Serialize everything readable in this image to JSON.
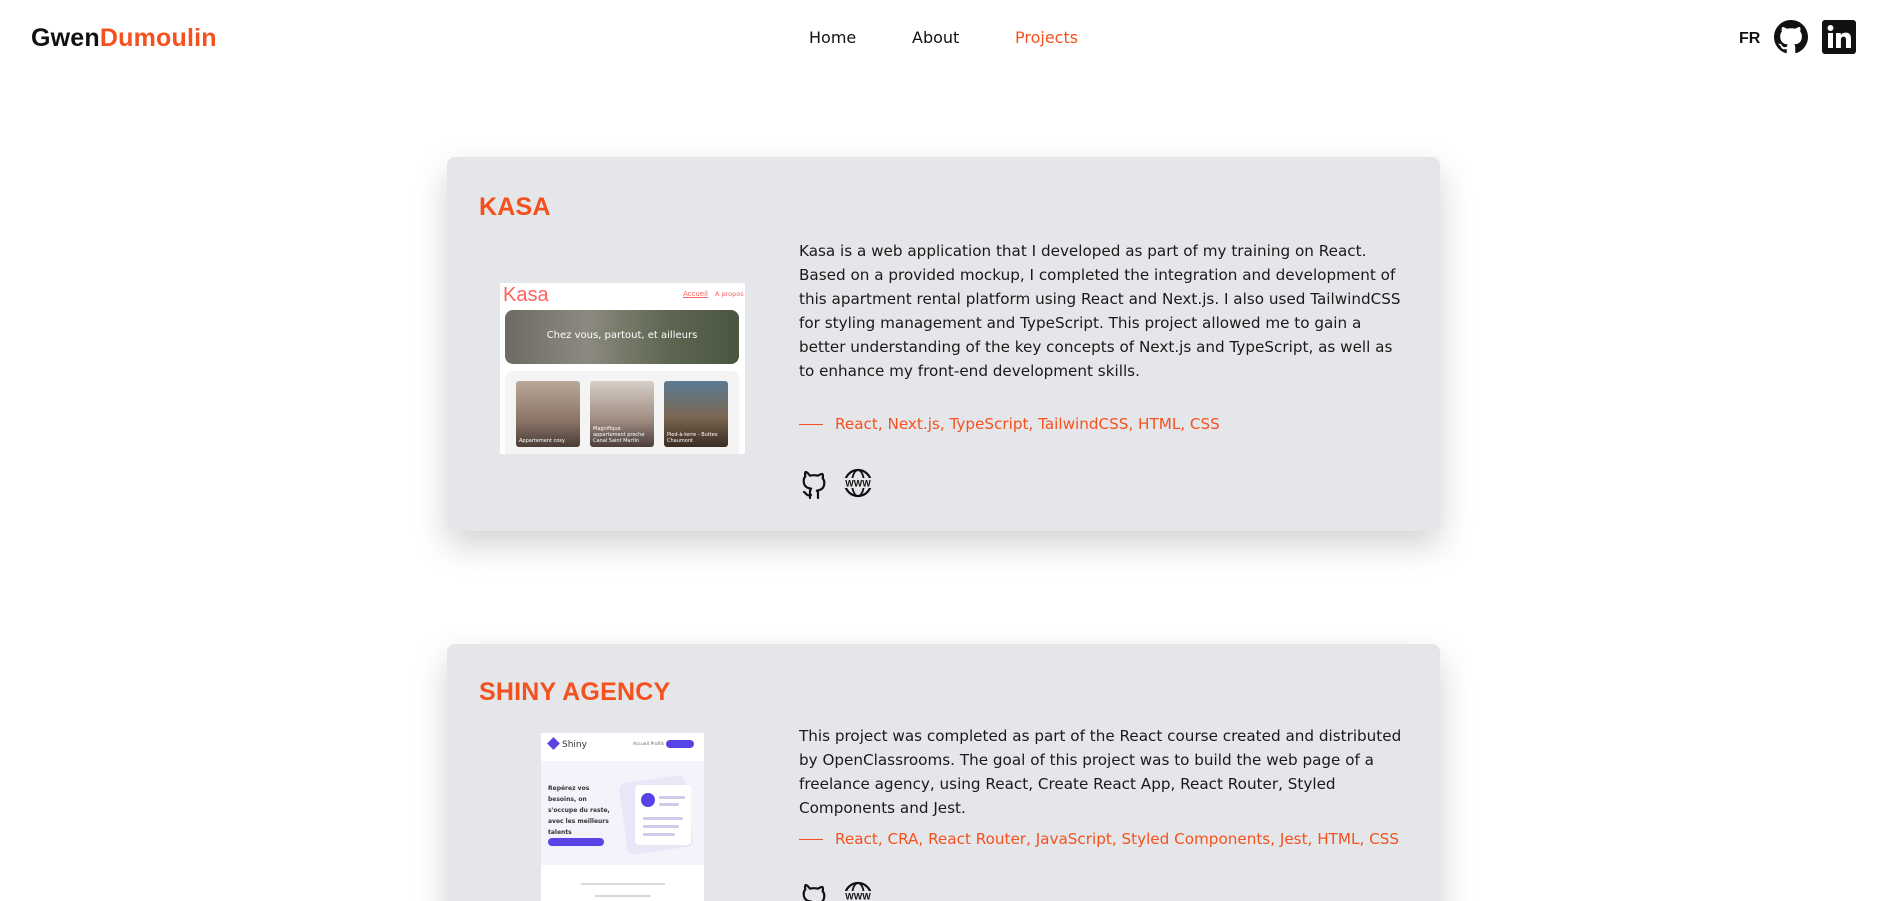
{
  "header": {
    "brand_first": "Gwen",
    "brand_last": "Dumoulin",
    "nav": [
      {
        "label": "Home",
        "active": false
      },
      {
        "label": "About",
        "active": false
      },
      {
        "label": "Projects",
        "active": true
      }
    ],
    "lang": "FR",
    "icons": [
      "github-icon",
      "linkedin-icon"
    ]
  },
  "colors": {
    "accent": "#f4511e",
    "card_bg": "#e5e6e9",
    "text": "#1a1a1a"
  },
  "projects": [
    {
      "title": "KASA",
      "description": "Kasa is a web application that I developed as part of my training on React. Based on a provided mockup, I completed the integration and development of this apartment rental platform using React and Next.js. I also used TailwindCSS for styling management and TypeScript. This project allowed me to gain a better understanding of the key concepts of Next.js and TypeScript, as well as to enhance my front-end development skills.",
      "tech": "React, Next.js, TypeScript, TailwindCSS, HTML, CSS",
      "links": [
        "github-icon",
        "website-icon"
      ],
      "thumbnail": {
        "logo": "Kasa",
        "nav_home": "Accueil",
        "nav_about": "A propos",
        "banner": "Chez vous, partout, et ailleurs",
        "cards": [
          "Appartement cosy",
          "Magnifique appartement proche Canal Saint Martin",
          "Pied-à-terre - Buttes Chaumont"
        ]
      }
    },
    {
      "title": "SHINY AGENCY",
      "description": "This project was completed as part of the React course created and distributed by OpenClassrooms. The goal of this project was to build the web page of a freelance agency, using React, Create React App, React Router, Styled Components and Jest.",
      "tech": "React, CRA, React Router, JavaScript, Styled Components, Jest, HTML, CSS",
      "links": [
        "github-icon",
        "website-icon"
      ],
      "thumbnail": {
        "logo": "Shiny",
        "nav": "Accueil   Profils",
        "hero": "Repérez vos besoins, on s'occupe du reste, avec les meilleurs talents"
      }
    }
  ]
}
